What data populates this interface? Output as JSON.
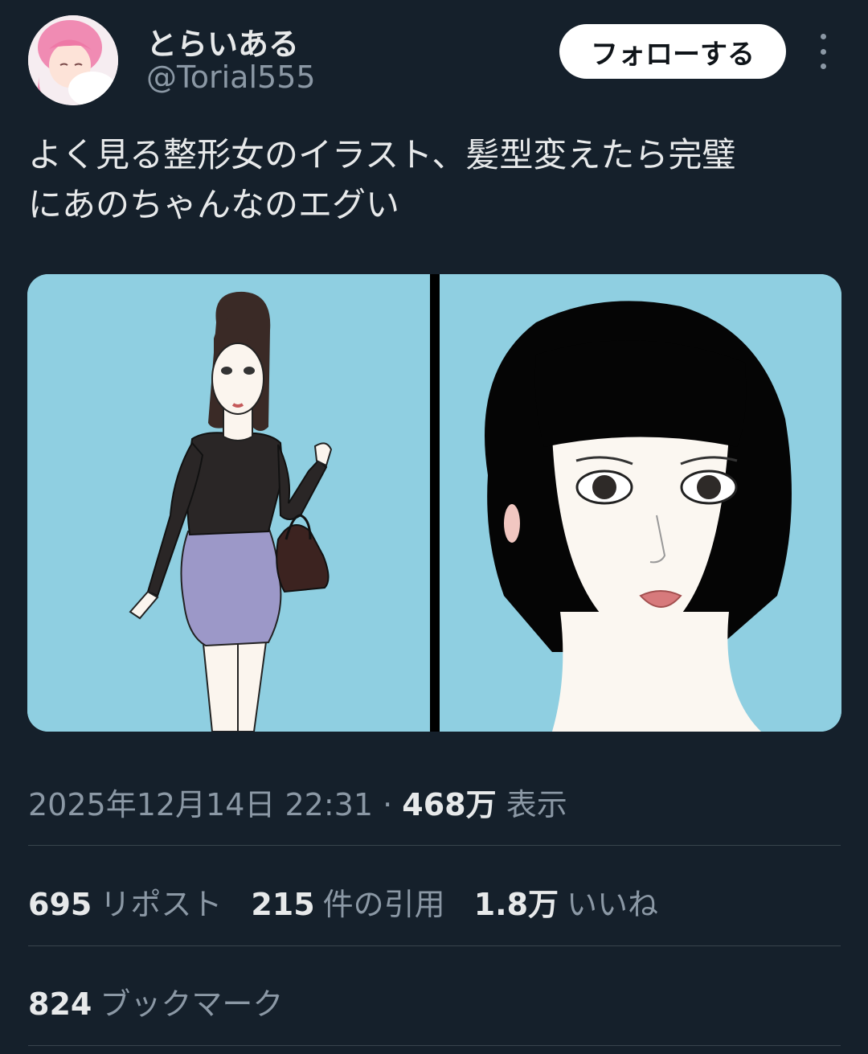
{
  "user": {
    "display_name": "とらいある",
    "handle": "@Torial555",
    "avatar_icon": "anime-avatar-icon"
  },
  "follow_button_label": "フォローする",
  "more_icon": "more-options-icon",
  "tweet": {
    "text_line1": "よく見る整形女のイラスト、髪型変えたら完璧",
    "text_line2": "にあのちゃんなのエグい"
  },
  "media": {
    "image1_icon": "illustration-full-body-woman",
    "image2_icon": "illustration-face-bob-hair",
    "background_color": "#8fcfe1"
  },
  "meta": {
    "timestamp": "2025年12月14日 22:31",
    "separator": "·",
    "views_count": "468万",
    "views_label": "表示"
  },
  "stats": {
    "reposts_count": "695",
    "reposts_label": "リポスト",
    "quotes_count": "215",
    "quotes_label": "件の引用",
    "likes_count": "1.8万",
    "likes_label": "いいね",
    "bookmarks_count": "824",
    "bookmarks_label": "ブックマーク"
  },
  "colors": {
    "background": "#15202b",
    "text_primary": "#e7e9ea",
    "text_secondary": "#8b98a5",
    "divider": "#38444d"
  }
}
